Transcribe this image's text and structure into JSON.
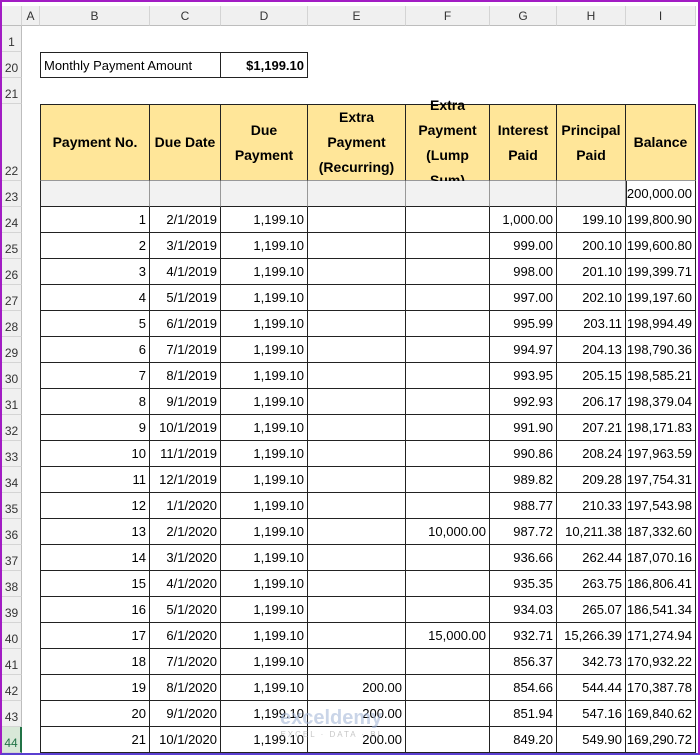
{
  "columns": [
    "A",
    "B",
    "C",
    "D",
    "E",
    "F",
    "G",
    "H",
    "I"
  ],
  "rows": [
    "1",
    "20",
    "21",
    "22",
    "23",
    "24",
    "25",
    "26",
    "27",
    "28",
    "29",
    "30",
    "31",
    "32",
    "33",
    "34",
    "35",
    "36",
    "37",
    "38",
    "39",
    "40",
    "41",
    "42",
    "43",
    "44"
  ],
  "summary": {
    "label": "Monthly Payment Amount",
    "value": "$1,199.10"
  },
  "headers": [
    "Payment No.",
    "Due Date",
    "Due Payment",
    "Extra Payment (Recurring)",
    "Extra Payment (Lump Sum)",
    "Interest Paid",
    "Principal Paid",
    "Balance"
  ],
  "opening_balance": "200,000.00",
  "table": [
    [
      "1",
      "2/1/2019",
      "1,199.10",
      "",
      "",
      "1,000.00",
      "199.10",
      "199,800.90"
    ],
    [
      "2",
      "3/1/2019",
      "1,199.10",
      "",
      "",
      "999.00",
      "200.10",
      "199,600.80"
    ],
    [
      "3",
      "4/1/2019",
      "1,199.10",
      "",
      "",
      "998.00",
      "201.10",
      "199,399.71"
    ],
    [
      "4",
      "5/1/2019",
      "1,199.10",
      "",
      "",
      "997.00",
      "202.10",
      "199,197.60"
    ],
    [
      "5",
      "6/1/2019",
      "1,199.10",
      "",
      "",
      "995.99",
      "203.11",
      "198,994.49"
    ],
    [
      "6",
      "7/1/2019",
      "1,199.10",
      "",
      "",
      "994.97",
      "204.13",
      "198,790.36"
    ],
    [
      "7",
      "8/1/2019",
      "1,199.10",
      "",
      "",
      "993.95",
      "205.15",
      "198,585.21"
    ],
    [
      "8",
      "9/1/2019",
      "1,199.10",
      "",
      "",
      "992.93",
      "206.17",
      "198,379.04"
    ],
    [
      "9",
      "10/1/2019",
      "1,199.10",
      "",
      "",
      "991.90",
      "207.21",
      "198,171.83"
    ],
    [
      "10",
      "11/1/2019",
      "1,199.10",
      "",
      "",
      "990.86",
      "208.24",
      "197,963.59"
    ],
    [
      "11",
      "12/1/2019",
      "1,199.10",
      "",
      "",
      "989.82",
      "209.28",
      "197,754.31"
    ],
    [
      "12",
      "1/1/2020",
      "1,199.10",
      "",
      "",
      "988.77",
      "210.33",
      "197,543.98"
    ],
    [
      "13",
      "2/1/2020",
      "1,199.10",
      "",
      "10,000.00",
      "987.72",
      "10,211.38",
      "187,332.60"
    ],
    [
      "14",
      "3/1/2020",
      "1,199.10",
      "",
      "",
      "936.66",
      "262.44",
      "187,070.16"
    ],
    [
      "15",
      "4/1/2020",
      "1,199.10",
      "",
      "",
      "935.35",
      "263.75",
      "186,806.41"
    ],
    [
      "16",
      "5/1/2020",
      "1,199.10",
      "",
      "",
      "934.03",
      "265.07",
      "186,541.34"
    ],
    [
      "17",
      "6/1/2020",
      "1,199.10",
      "",
      "15,000.00",
      "932.71",
      "15,266.39",
      "171,274.94"
    ],
    [
      "18",
      "7/1/2020",
      "1,199.10",
      "",
      "",
      "856.37",
      "342.73",
      "170,932.22"
    ],
    [
      "19",
      "8/1/2020",
      "1,199.10",
      "200.00",
      "",
      "854.66",
      "544.44",
      "170,387.78"
    ],
    [
      "20",
      "9/1/2020",
      "1,199.10",
      "200.00",
      "",
      "851.94",
      "547.16",
      "169,840.62"
    ],
    [
      "21",
      "10/1/2020",
      "1,199.10",
      "200.00",
      "",
      "849.20",
      "549.90",
      "169,290.72"
    ]
  ],
  "watermark": {
    "name": "exceldemy",
    "tagline": "EXCEL · DATA · BI"
  },
  "colors": {
    "header_fill": "#ffe699",
    "frame": "#a21cc4"
  }
}
